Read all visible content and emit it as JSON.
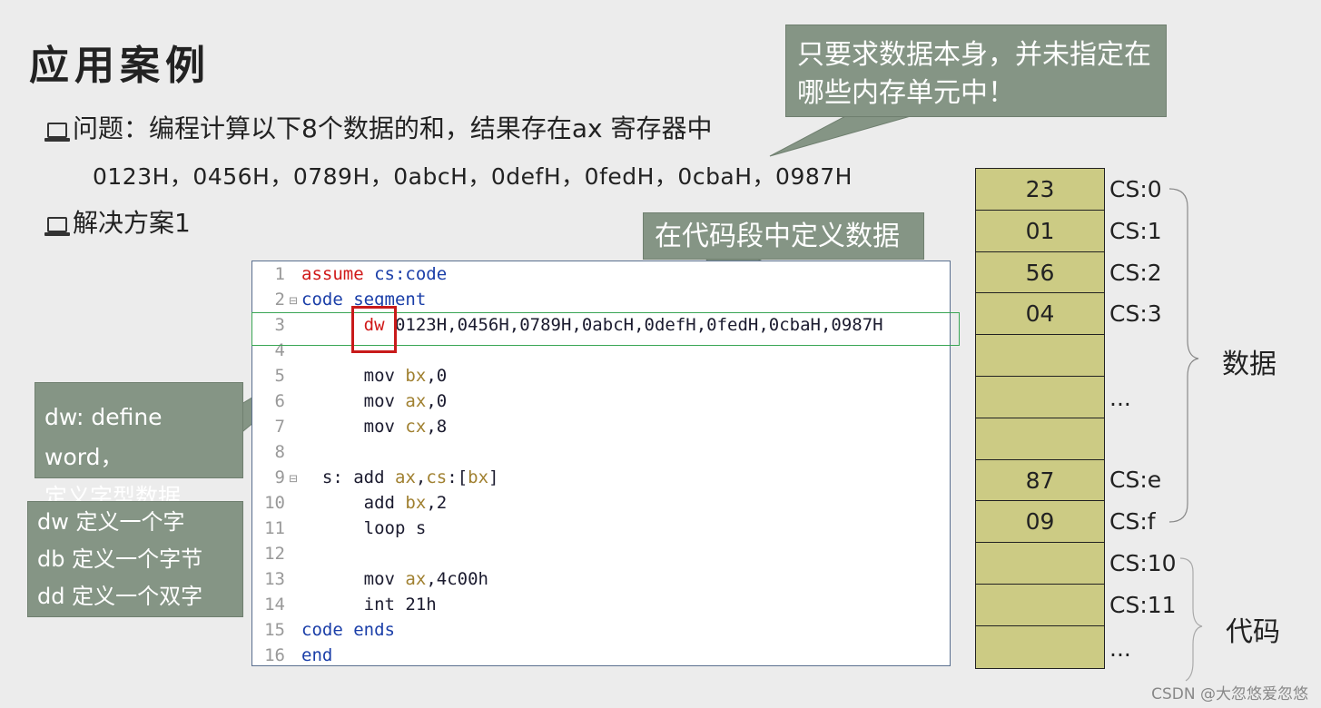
{
  "title": "应用案例",
  "bullets": {
    "problem": "问题：编程计算以下8个数据的和，结果存在ax 寄存器中",
    "data_values": "0123H，0456H，0789H，0abcH，0defH，0fedH，0cbaH，0987H",
    "solution": "解决方案1"
  },
  "callouts": {
    "top_line1": "只要求数据本身，并未指定在",
    "top_line2": "哪些内存单元中！",
    "middle": "在代码段中定义数据",
    "left_line1": "dw: define word，",
    "left_line2": "定义字型数据",
    "defs": [
      "dw 定义一个字",
      "db 定义一个字节",
      "dd 定义一个双字"
    ]
  },
  "code": {
    "line_numbers": [
      "1",
      "2",
      "3",
      "4",
      "5",
      "6",
      "7",
      "8",
      "9",
      "10",
      "11",
      "12",
      "13",
      "14",
      "15",
      "16"
    ],
    "l1_kw": "assume",
    "l1_rest": " cs:code",
    "l2_kw": "code segment",
    "l3_kw": "dw",
    "l3_rest": " 0123H,0456H,0789H,0abcH,0defH,0fedH,0cbaH,0987H",
    "l5": {
      "op": "mov",
      "reg": "bx",
      "rest": ",0"
    },
    "l6": {
      "op": "mov",
      "reg": "ax",
      "rest": ",0"
    },
    "l7": {
      "op": "mov",
      "reg": "cx",
      "rest": ",8"
    },
    "l9": {
      "label": "s:",
      "op": "add",
      "reg": "ax",
      "sep": ",",
      "seg": "cs",
      "colon": ":",
      "bracket_open": "[",
      "reg2": "bx",
      "bracket_close": "]"
    },
    "l10": {
      "op": "add",
      "reg": "bx",
      "rest": ",2"
    },
    "l11": {
      "op": "loop",
      "rest": " s"
    },
    "l13": {
      "op": "mov",
      "reg": "ax",
      "rest": ",4c00h"
    },
    "l14": {
      "op": "int",
      "rest": " 21h"
    },
    "l15": "code ends",
    "l16": "end"
  },
  "memory": {
    "cells": [
      "23",
      "01",
      "56",
      "04",
      "",
      "",
      "",
      "87",
      "09",
      "",
      "",
      ""
    ],
    "addresses": [
      "CS:0",
      "CS:1",
      "CS:2",
      "CS:3",
      "...",
      "CS:e",
      "CS:f",
      "CS:10",
      "CS:11",
      "..."
    ],
    "label_data": "数据",
    "label_code": "代码"
  },
  "watermark": "CSDN @大忽悠爱忽悠",
  "colors": {
    "callout_bg": "#859585",
    "mem_cell": "#cccb84",
    "keyword_red": "#d01818",
    "keyword_blue": "#1a3ea8",
    "highlight_green": "#3aa655"
  }
}
